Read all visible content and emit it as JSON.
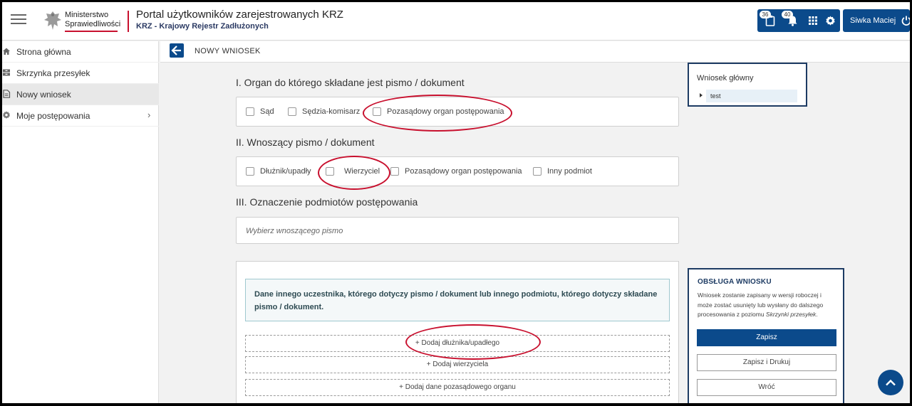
{
  "header": {
    "logo": {
      "line1": "Ministerstwo",
      "line2": "Sprawiedliwości"
    },
    "title": "Portal użytkowników zarejestrowanych KRZ",
    "subtitle": "KRZ - Krajowy Rejestr Zadłużonych",
    "badges": {
      "messages": "36",
      "notifications": "40"
    },
    "icons": [
      "clipboard-icon",
      "bell-icon",
      "apps-grid-icon",
      "gear-icon",
      "power-icon"
    ],
    "user_name": "Siwka Maciej"
  },
  "sidebar": {
    "items": [
      {
        "label": "Strona główna",
        "icon": "home-icon"
      },
      {
        "label": "Skrzynka przesyłek",
        "icon": "inbox-icon"
      },
      {
        "label": "Nowy wniosek",
        "icon": "document-icon"
      },
      {
        "label": "Moje postępowania",
        "icon": "gear-icon"
      }
    ]
  },
  "page": {
    "title": "NOWY WNIOSEK"
  },
  "form": {
    "section1": {
      "title": "I. Organ do którego składane jest pismo / dokument",
      "options": [
        "Sąd",
        "Sędzia-komisarz",
        "Pozasądowy organ postępowania"
      ]
    },
    "section2": {
      "title": "II. Wnoszący pismo / dokument",
      "options": [
        "Dłużnik/upadły",
        "Wierzyciel",
        "Pozasądowy organ postępowania",
        "Inny podmiot"
      ]
    },
    "section3": {
      "title": "III. Oznaczenie podmiotów postępowania",
      "placeholder": "Wybierz wnoszącego pismo"
    },
    "info": "Dane innego uczestnika, którego dotyczy pismo / dokument lub innego podmiotu, którego dotyczy składane pismo / dokument.",
    "add_buttons": [
      "+ Dodaj dłużnika/upadłego",
      "+ Dodaj wierzyciela",
      "+ Dodaj dane pozasądowego organu"
    ]
  },
  "tree": {
    "title": "Wniosek główny",
    "item": "test"
  },
  "obsluga": {
    "title": "OBSŁUGA WNIOSKU",
    "text_before": "Wniosek zostanie zapisany w wersji roboczej i może zostać usunięty lub wysłany do dalszego procesowania z poziomu ",
    "text_link": "Skrzynki przesyłek",
    "text_after": ".",
    "buttons": {
      "save": "Zapisz",
      "save_print": "Zapisz i Drukuj",
      "back": "Wróć"
    }
  },
  "colors": {
    "primary": "#0b4a8b",
    "annotation_red": "#c8102e",
    "accent_red": "#c8102e"
  }
}
